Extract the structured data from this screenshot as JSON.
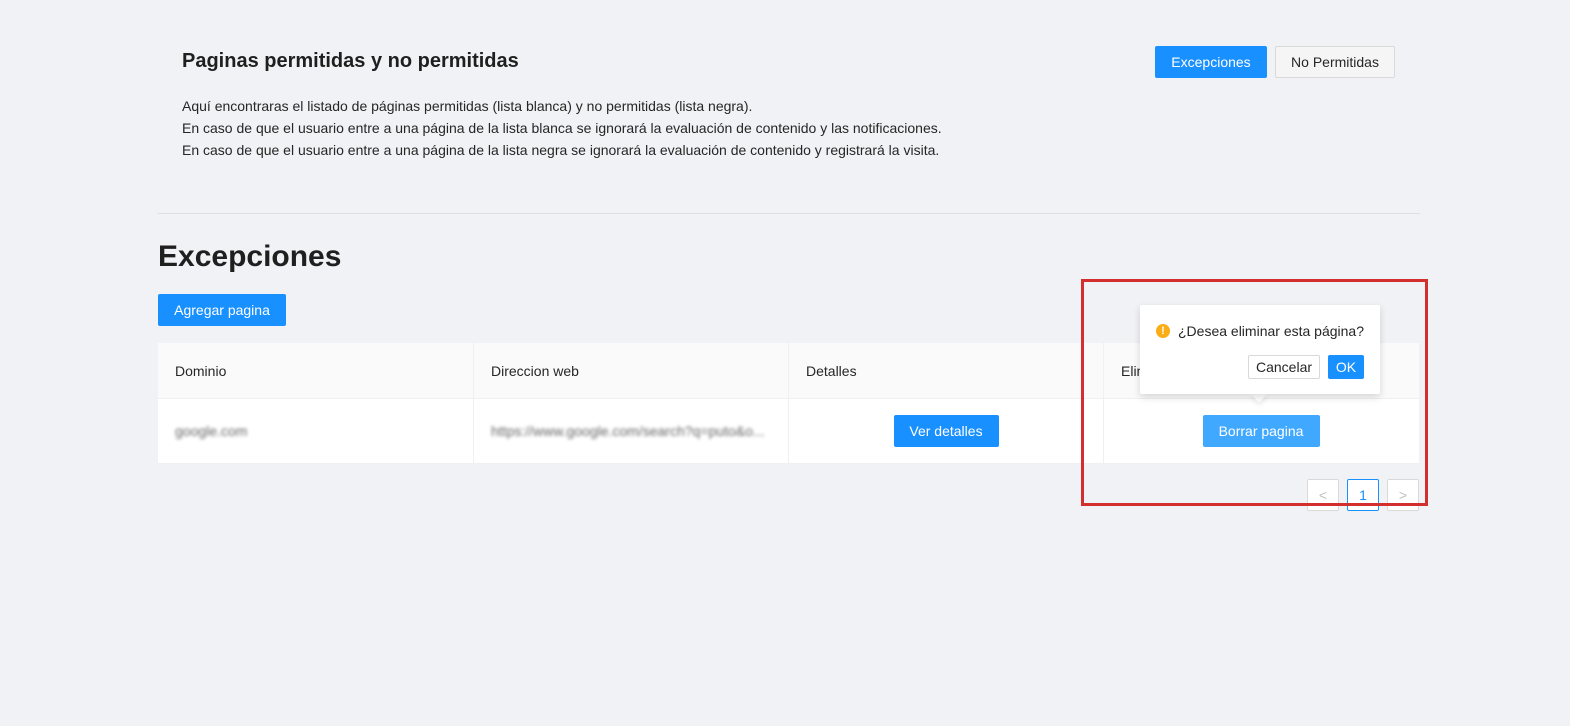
{
  "header": {
    "title": "Paginas permitidas y no permitidas",
    "tabs": [
      "Excepciones",
      "No Permitidas"
    ],
    "description": [
      "Aquí encontraras el listado de páginas permitidas (lista blanca) y no permitidas (lista negra).",
      "En caso de que el usuario entre a una página de la lista blanca se ignorará la evaluación de contenido y las notificaciones.",
      "En caso de que el usuario entre a una página de la lista negra se ignorará la evaluación de contenido y registrará la visita."
    ]
  },
  "section": {
    "title": "Excepciones",
    "add_button": "Agregar pagina"
  },
  "table": {
    "columns": [
      "Dominio",
      "Direccion web",
      "Detalles",
      "Elim"
    ],
    "rows": [
      {
        "domain": "google.com",
        "url": "https://www.google.com/search?q=puto&o...",
        "details_button": "Ver detalles",
        "delete_button": "Borrar pagina"
      }
    ]
  },
  "pagination": {
    "prev": "<",
    "current": "1",
    "next": ">"
  },
  "popconfirm": {
    "message": "¿Desea eliminar esta página?",
    "cancel": "Cancelar",
    "ok": "OK",
    "icon": "exclamation-circle-icon",
    "icon_glyph": "!",
    "icon_color": "#faad14"
  },
  "colors": {
    "primary": "#1890ff",
    "highlight_border": "#d32f2f"
  }
}
